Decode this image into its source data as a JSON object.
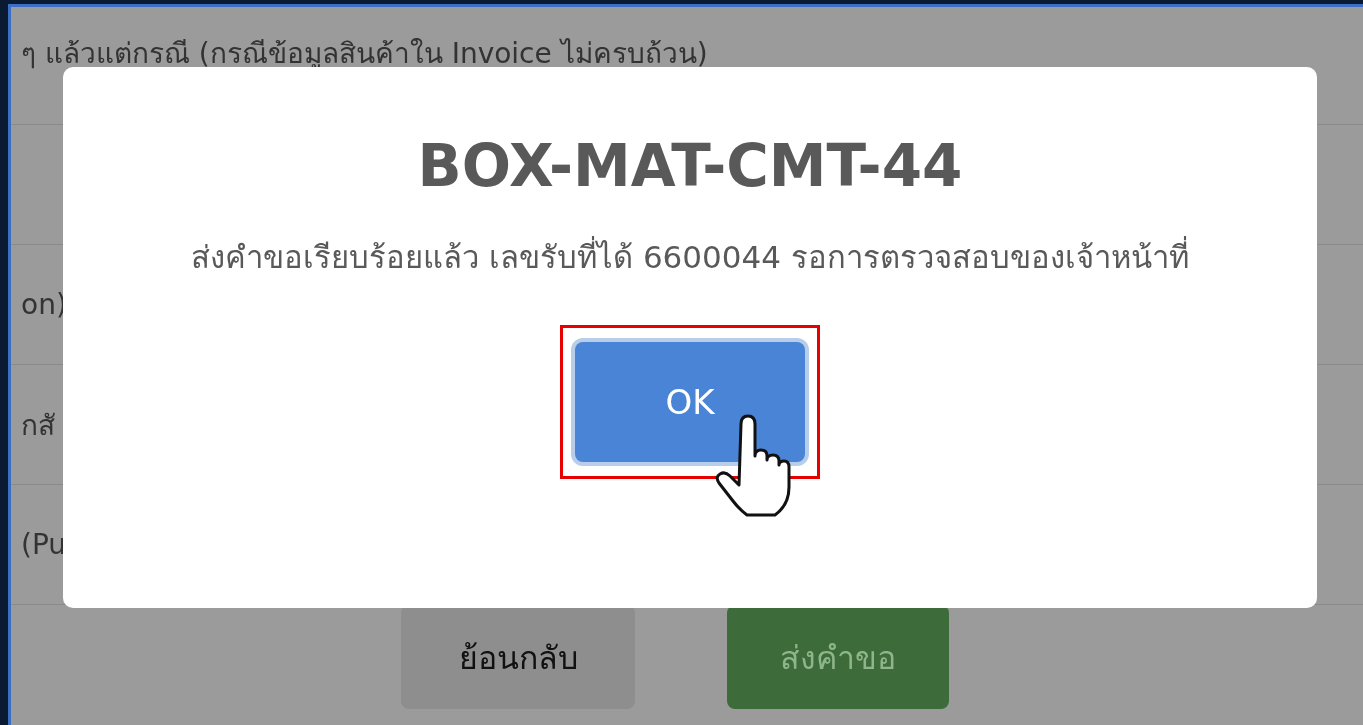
{
  "background": {
    "rows": [
      {
        "text": "ๆ แล้วแต่กรณี (กรณีข้อมูลสินค้าใน Invoice ไม่ครบถ้วน)"
      },
      {
        "text": "on)"
      },
      {
        "text": "กสั"
      },
      {
        "text": "(Pu"
      }
    ],
    "buttons": [
      {
        "label": "ย้อนกลับ",
        "kind": "secondary"
      },
      {
        "label": "ส่งคำขอ",
        "kind": "primary"
      }
    ]
  },
  "dialog": {
    "title": "BOX-MAT-CMT-44",
    "message": "ส่งคำขอเรียบร้อยแล้ว เลขรับที่ได้ 6600044 รอการตรวจสอบของเจ้าหน้าที่",
    "ok_button": {
      "label": "OK",
      "highlighted": true
    }
  }
}
